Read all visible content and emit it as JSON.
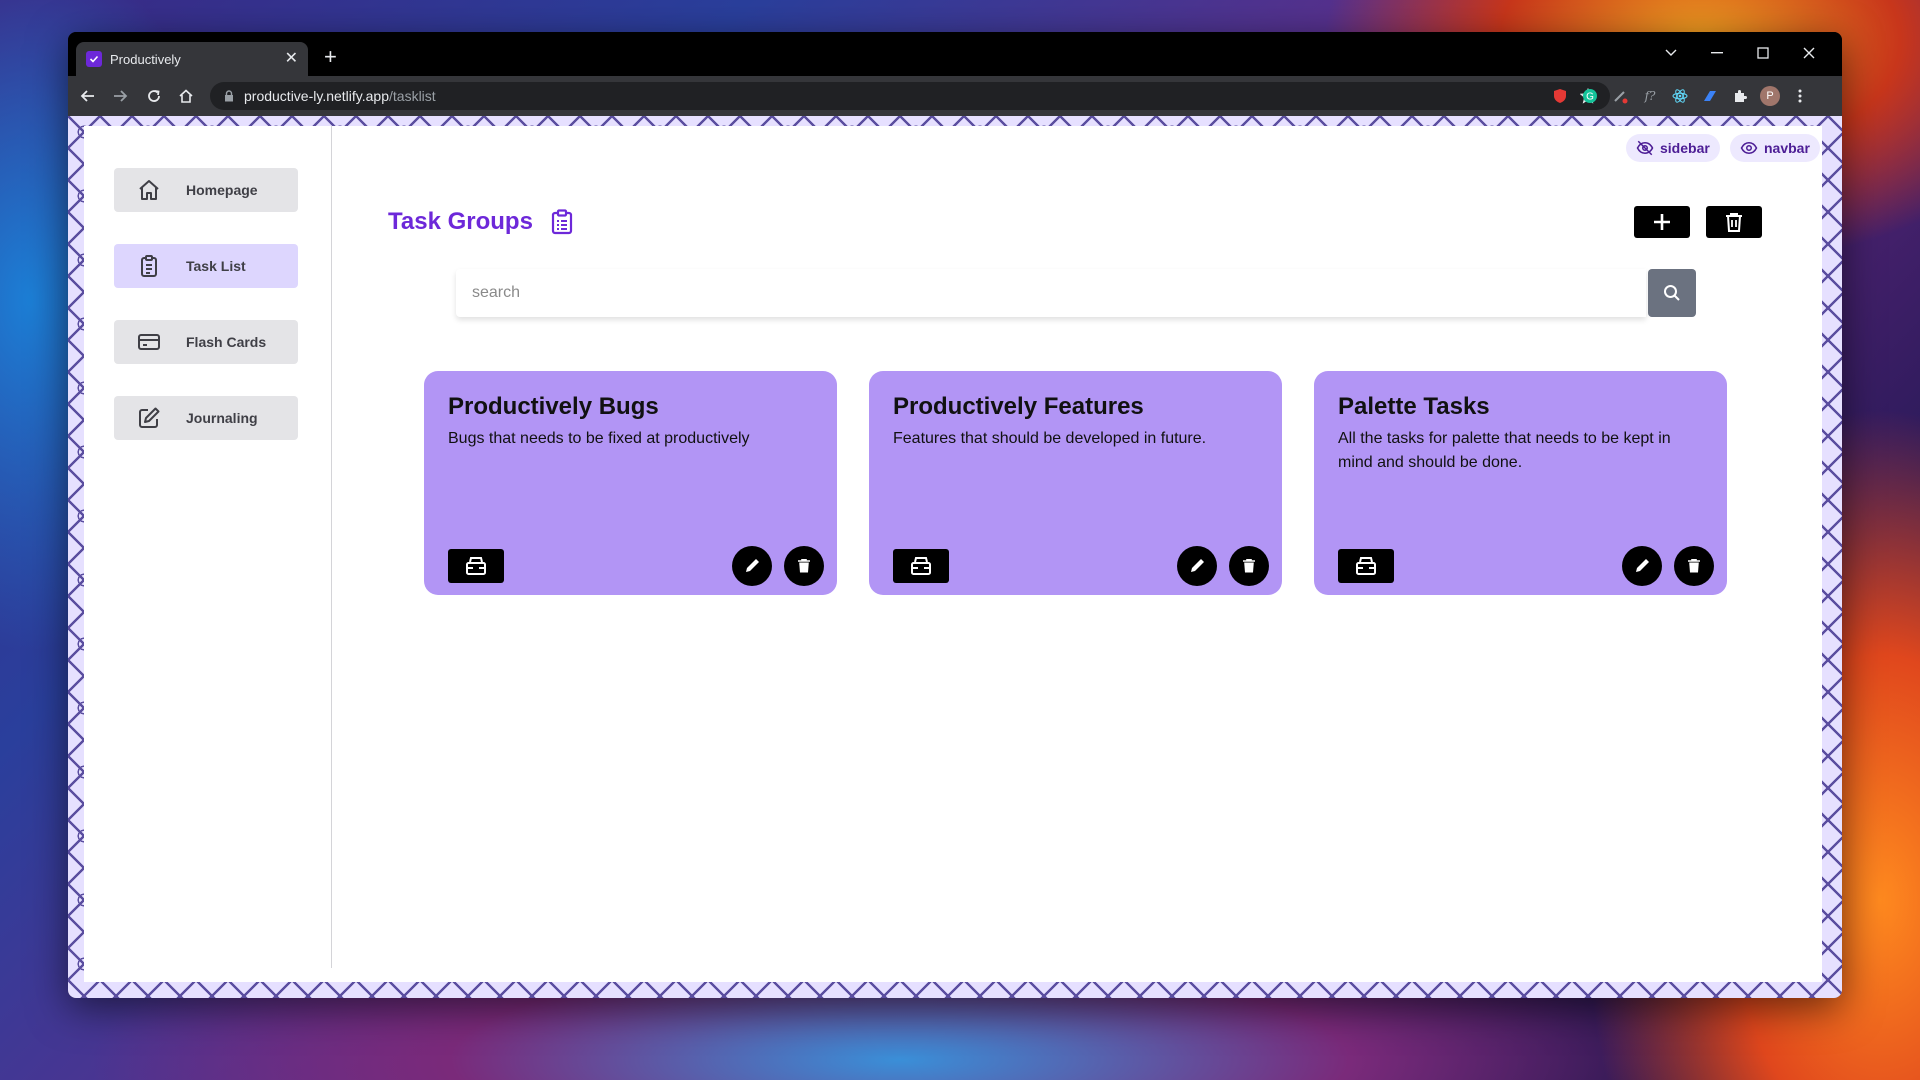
{
  "browser": {
    "tab_title": "Productively",
    "url_host": "productive-ly.netlify.app",
    "url_path": "/tasklist",
    "profile_initial": "P"
  },
  "sidebar": {
    "items": [
      {
        "label": "Homepage",
        "icon": "home-icon",
        "active": false
      },
      {
        "label": "Task List",
        "icon": "clipboard-list-icon",
        "active": true
      },
      {
        "label": "Flash Cards",
        "icon": "credit-card-icon",
        "active": false
      },
      {
        "label": "Journaling",
        "icon": "edit-icon",
        "active": false
      }
    ]
  },
  "toggles": {
    "sidebar_label": "sidebar",
    "navbar_label": "navbar"
  },
  "header": {
    "title": "Task Groups"
  },
  "search": {
    "placeholder": "search",
    "value": ""
  },
  "task_groups": [
    {
      "title": "Productively Bugs",
      "description": "Bugs that needs to be fixed at productively"
    },
    {
      "title": "Productively Features",
      "description": "Features that should be developed in future."
    },
    {
      "title": "Palette Tasks",
      "description": "All the tasks for palette that needs to be kept in mind and should be done."
    }
  ],
  "colors": {
    "accent": "#6d28d9",
    "card_background": "#b295f5",
    "active_sidebar": "#ddd6fe"
  }
}
